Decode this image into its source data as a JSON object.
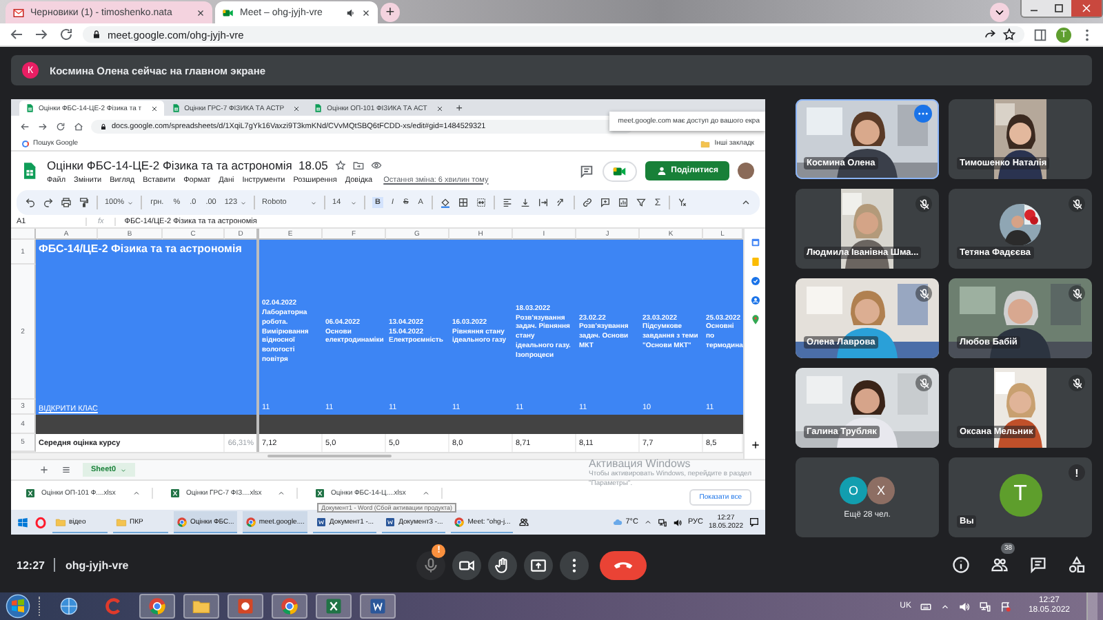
{
  "browser": {
    "tabs": [
      {
        "title": "Черновики (1) - timoshenko.nata",
        "audible": false,
        "selected": false
      },
      {
        "title": "Meet – ohg-jyjh-vre",
        "audible": true,
        "selected": true
      }
    ],
    "new_tab": "+",
    "address": "meet.google.com/ohg-jyjh-vre",
    "profile": "T"
  },
  "banner": {
    "initial": "К",
    "text": "Космина Олена сейчас на главном экране"
  },
  "shared_screen": {
    "tabs": [
      {
        "title": "Оцінки ФБС-14-ЦЕ-2 Фізика та т",
        "selected": true
      },
      {
        "title": "Оцінки ГРС-7 ФІЗИКА ТА АСТР",
        "selected": false
      },
      {
        "title": "Оцінки ОП-101 ФІЗИКА ТА АСТ",
        "selected": false
      }
    ],
    "new_tab": "+",
    "address": "docs.google.com/spreadsheets/d/1XqiL7gYk16Vaxzi9T3kmKNd/CVvMQtSBQ6tFCDD-xs/edit#gid=1484529321",
    "share_notice": "meet.google.com має доступ до вашого екра",
    "bookmark": "Пошук Google",
    "other_bookmarks": "Інші закладк",
    "sheet": {
      "title": "Оцінки ФБС-14-ЦЕ-2 Фізика та та астрономія  18.05",
      "menu": [
        "Файл",
        "Змінити",
        "Вигляд",
        "Вставити",
        "Формат",
        "Дані",
        "Інструменти",
        "Розширення",
        "Довідка"
      ],
      "last_edit": "Остання зміна: 6 хвилин тому",
      "share": "Поділитися",
      "zoom": "100%",
      "number_formats": [
        "грн.",
        "%",
        ".0",
        ".00"
      ],
      "more_formats": "123",
      "font": "Roboto",
      "font_size": "14",
      "text_styles": [
        "B",
        "I",
        "S",
        "A"
      ],
      "functions": "Σ",
      "cell_ref": "A1",
      "fx": "fx",
      "formula": "ФБС-14/ЦЕ-2 Фізика та та астрономія",
      "columns": [
        "A",
        "B",
        "C",
        "D",
        "E",
        "F",
        "G",
        "H",
        "I",
        "J",
        "K",
        "L"
      ],
      "row_numbers": [
        "1",
        "2",
        "3",
        "4",
        "5"
      ],
      "title_cell": "ФБС-14/ЦЕ-2 Фізика та та астрономія",
      "link_cell": "ВІДКРИТИ КЛАС",
      "avg_label": "Середня оцінка курсу",
      "avg_percent": "66,31%",
      "assignments": [
        {
          "header": "02.04.2022 Лабораторна робота. Вимірювання відносної вологості повітря",
          "count": "11",
          "avg": "7,12"
        },
        {
          "header": "06.04.2022 Основи електродинаміки",
          "count": "11",
          "avg": "5,0"
        },
        {
          "header": "13.04.2022 15.04.2022 Електроємність",
          "count": "11",
          "avg": "5,0"
        },
        {
          "header": "16.03.2022 Рівняння стану ідеального газу",
          "count": "11",
          "avg": "8,0"
        },
        {
          "header": "18.03.2022 Розв'язування задач. Рівняння стану ідеального газу. Ізопроцеси",
          "count": "11",
          "avg": "8,71"
        },
        {
          "header": "23.02.22 Розв'язування задач. Основи МКТ",
          "count": "11",
          "avg": "8,11"
        },
        {
          "header": "23.03.2022 Підсумкове завдання з теми \"Основи МКТ\"",
          "count": "10",
          "avg": "7,7"
        },
        {
          "header": "25.03.2022 Основні по термодина",
          "count": "11",
          "avg": "8,5"
        }
      ],
      "sheet_tab": "Sheet0"
    },
    "activation": {
      "title": "Активация Windows",
      "text": "Чтобы активировать Windows, перейдите в раздел \"Параметры\"."
    },
    "downloads": [
      "Оцінки ОП-101 Ф....xlsx",
      "Оцінки ГРС-7 ФІЗ....xlsx",
      "Оцінки ФБС-14-Ц....xlsx"
    ],
    "show_all": "Показати все",
    "tooltip": "Документ1 - Word (Сбой активации продукта)",
    "taskbar": {
      "items": [
        {
          "label": "відео",
          "kind": "folder",
          "selected": false
        },
        {
          "label": "ПКР",
          "kind": "folder",
          "selected": false
        },
        {
          "label": "Оцінки ФБС...",
          "kind": "browser",
          "selected": true
        },
        {
          "label": "meet.google....",
          "kind": "browser",
          "selected": true
        },
        {
          "label": "Документ1 -...",
          "kind": "document",
          "selected": false
        },
        {
          "label": "Документ3 -...",
          "kind": "document",
          "selected": false
        },
        {
          "label": "Meet: \"ohg-j...",
          "kind": "browser",
          "selected": false
        }
      ],
      "weather": "7°C",
      "language": "РУС",
      "time": "12:27",
      "date": "18.05.2022"
    }
  },
  "participants": [
    {
      "name": "Космина Олена",
      "kind": "video",
      "muted": false,
      "speaking": true,
      "options_shown": true
    },
    {
      "name": "Тимошенко Наталія",
      "kind": "portrait",
      "muted": false,
      "speaking": false,
      "options_shown": false
    },
    {
      "name": "Людмила Іванівна Шма...",
      "kind": "portrait",
      "muted": true,
      "speaking": false,
      "options_shown": false
    },
    {
      "name": "Тетяна Фадєєва",
      "kind": "avatar",
      "muted": true,
      "speaking": false,
      "options_shown": false
    },
    {
      "name": "Олена Лаврова",
      "kind": "video",
      "muted": true,
      "speaking": false,
      "options_shown": false
    },
    {
      "name": "Любов Бабій",
      "kind": "video",
      "muted": true,
      "speaking": false,
      "options_shown": false
    },
    {
      "name": "Галина Трубляк",
      "kind": "video",
      "muted": true,
      "speaking": false,
      "options_shown": false
    },
    {
      "name": "Оксана Мельник",
      "kind": "portrait",
      "muted": true,
      "speaking": false,
      "options_shown": false
    }
  ],
  "others": {
    "avatars": [
      {
        "letter": "O",
        "color": "#129eaf"
      },
      {
        "letter": "X",
        "color": "#8d6e63"
      }
    ],
    "label": "Ещё 28 чел."
  },
  "self": {
    "initial": "T",
    "label": "Вы",
    "alert": "!"
  },
  "footer": {
    "time": "12:27",
    "code": "ohg-jyjh-vre",
    "mic_alert": "!",
    "people_count": "38"
  },
  "desktop_taskbar": {
    "language": "UK",
    "time": "12:27",
    "date": "18.05.2022"
  }
}
